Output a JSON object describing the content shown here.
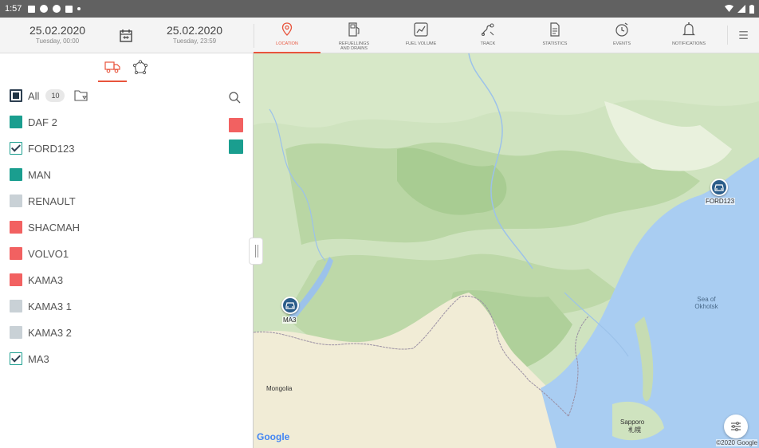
{
  "status_bar": {
    "time": "1:57"
  },
  "date_from": {
    "date": "25.02.2020",
    "sub": "Tuesday, 00:00"
  },
  "date_to": {
    "date": "25.02.2020",
    "sub": "Tuesday, 23:59"
  },
  "nav_tabs": [
    {
      "label": "LOCATION",
      "icon": "location-pin-icon"
    },
    {
      "label": "REFUELLINGS AND DRAINS",
      "icon": "fuel-pump-icon"
    },
    {
      "label": "FUEL VOLUME",
      "icon": "fuel-chart-icon"
    },
    {
      "label": "TRACK",
      "icon": "track-route-icon"
    },
    {
      "label": "STATISTICS",
      "icon": "statistics-document-icon"
    },
    {
      "label": "EVENTS",
      "icon": "events-clock-icon"
    },
    {
      "label": "NOTIFICATIONS",
      "icon": "bell-icon"
    }
  ],
  "sidebar": {
    "all_label": "All",
    "all_count": "10",
    "vehicles": [
      {
        "name": "DAF 2",
        "color": "#1a9e8f",
        "checked": false
      },
      {
        "name": "FORD123",
        "color": "#1a9e8f",
        "checked": true
      },
      {
        "name": "MAN",
        "color": "#1a9e8f",
        "checked": false
      },
      {
        "name": "RENAULT",
        "color": "#c9d1d6",
        "checked": false
      },
      {
        "name": "SHACMAH",
        "color": "#f26161",
        "checked": false
      },
      {
        "name": "VOLVO1",
        "color": "#f26161",
        "checked": false
      },
      {
        "name": "KAMA3",
        "color": "#f26161",
        "checked": false
      },
      {
        "name": "KAMA3 1",
        "color": "#c9d1d6",
        "checked": false
      },
      {
        "name": "KAMA3 2",
        "color": "#c9d1d6",
        "checked": false
      },
      {
        "name": "MA3",
        "color": "#1a9e8f",
        "checked": true
      }
    ],
    "color_filters": [
      "#f26161",
      "#1a9e8f"
    ]
  },
  "map": {
    "labels": {
      "mongolia": "Mongolia",
      "sea": "Sea of Okhotsk",
      "sapporo": "Sapporo",
      "sapporo_jp": "札幌"
    },
    "markers": [
      {
        "name": "FORD123"
      },
      {
        "name": "MA3"
      }
    ],
    "google": "Google",
    "copyright": "©2020 Google"
  },
  "colors": {
    "accent": "#e8543c",
    "teal": "#1a9e8f",
    "red": "#f26161",
    "grey": "#c9d1d6"
  }
}
